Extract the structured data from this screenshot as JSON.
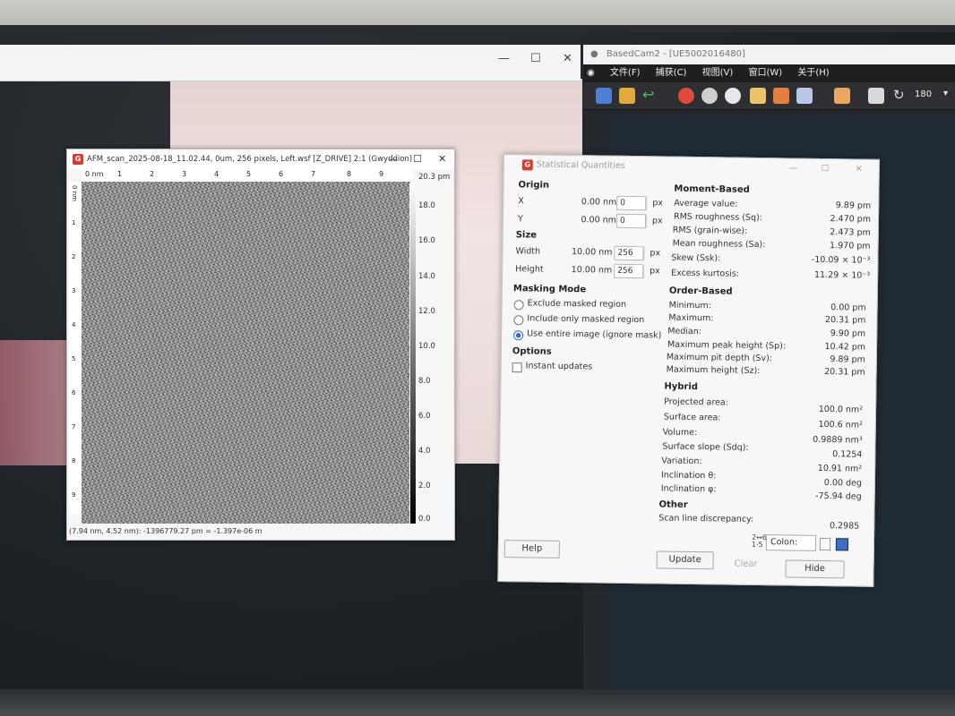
{
  "camera": {
    "title": "BasedCam2 - [UE5002016480]",
    "menu": [
      "文件(F)",
      "捕获(C)",
      "视图(V)",
      "窗口(W)",
      "关于(H)"
    ],
    "zoom": "180"
  },
  "left_window": {
    "controls": [
      "—",
      "☐",
      "✕"
    ]
  },
  "image_window": {
    "title": "AFM_scan_2025-08-18_11.02.44, 0um, 256 pixels, Left.wsf [Z_DRIVE] 2:1 (Gwyddion)",
    "ruler_x": [
      "0 nm",
      "1",
      "2",
      "3",
      "4",
      "5",
      "6",
      "7",
      "8",
      "9"
    ],
    "ruler_y": [
      "0 nm",
      "1",
      "2",
      "3",
      "4",
      "5",
      "6",
      "7",
      "8",
      "9"
    ],
    "scale": [
      "20.3 pm",
      "18.0",
      "16.0",
      "14.0",
      "12.0",
      "10.0",
      "8.0",
      "6.0",
      "4.0",
      "2.0",
      "0.0"
    ],
    "status": "(7.94 nm, 4.52 nm): -1396779.27 pm = -1.397e-06 m",
    "controls": [
      "—",
      "☐",
      "✕"
    ]
  },
  "stats": {
    "title": "Statistical Quantities",
    "origin": {
      "header": "Origin",
      "x_label": "X",
      "x_value": "0.00 nm",
      "x_px": "0",
      "y_label": "Y",
      "y_value": "0.00 nm",
      "y_px": "0",
      "unit": "px"
    },
    "size": {
      "header": "Size",
      "w_label": "Width",
      "w_value": "10.00 nm",
      "w_px": "256",
      "h_label": "Height",
      "h_value": "10.00 nm",
      "h_px": "256",
      "unit": "px"
    },
    "masking": {
      "header": "Masking Mode",
      "options": [
        "Exclude masked region",
        "Include only masked region",
        "Use entire image (ignore mask)"
      ],
      "selected": 2
    },
    "options": {
      "header": "Options",
      "instant": "Instant updates"
    },
    "moment": {
      "header": "Moment-Based",
      "rows": [
        {
          "label": "Average value:",
          "value": "9.89 pm"
        },
        {
          "label": "RMS roughness (Sq):",
          "value": "2.470 pm"
        },
        {
          "label": "RMS (grain-wise):",
          "value": "2.473 pm"
        },
        {
          "label": "Mean roughness (Sa):",
          "value": "1.970 pm"
        },
        {
          "label": "Skew (Ssk):",
          "value": "-10.09 × 10⁻³"
        },
        {
          "label": "Excess kurtosis:",
          "value": "11.29 × 10⁻³"
        }
      ]
    },
    "order": {
      "header": "Order-Based",
      "rows": [
        {
          "label": "Minimum:",
          "value": "0.00 pm"
        },
        {
          "label": "Maximum:",
          "value": "20.31 pm"
        },
        {
          "label": "Median:",
          "value": "9.90 pm"
        },
        {
          "label": "Maximum peak height (Sp):",
          "value": "10.42 pm"
        },
        {
          "label": "Maximum pit depth (Sv):",
          "value": "9.89 pm"
        },
        {
          "label": "Maximum height (Sz):",
          "value": "20.31 pm"
        }
      ]
    },
    "hybrid": {
      "header": "Hybrid",
      "rows": [
        {
          "label": "Projected area:",
          "value": "100.0 nm²"
        },
        {
          "label": "Surface area:",
          "value": "100.6 nm²"
        },
        {
          "label": "Volume:",
          "value": "0.9889 nm³"
        },
        {
          "label": "Surface slope (Sdq):",
          "value": "0.1254"
        },
        {
          "label": "Variation:",
          "value": "10.91 nm²"
        },
        {
          "label": "Inclination θ:",
          "value": "0.00 deg"
        },
        {
          "label": "Inclination φ:",
          "value": "-75.94 deg"
        }
      ]
    },
    "other": {
      "header": "Other",
      "rows": [
        {
          "label": "Scan line discrepancy:",
          "value": "0.2985"
        }
      ]
    },
    "color_label": "Colon:",
    "buttons": {
      "help": "Help",
      "update": "Update",
      "clear": "Clear",
      "hide": "Hide"
    },
    "controls": [
      "—",
      "☐",
      "✕"
    ]
  }
}
